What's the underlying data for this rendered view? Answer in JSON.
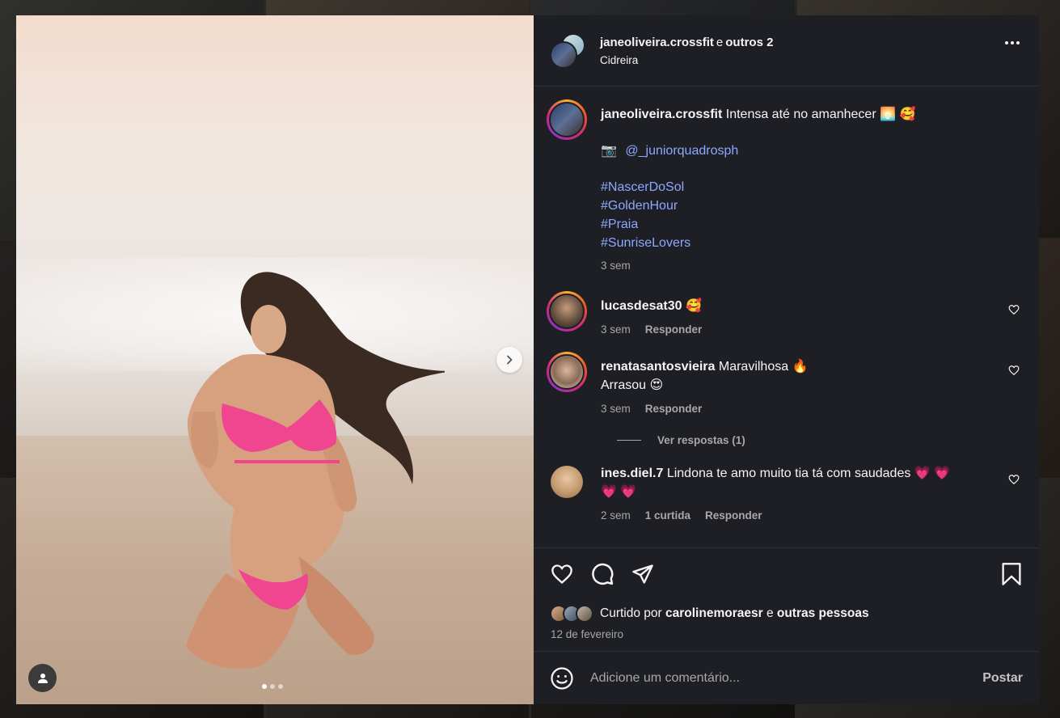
{
  "header": {
    "username": "janeoliveira.crossfit",
    "connector": "e",
    "others": "outros 2",
    "location": "Cidreira"
  },
  "caption": {
    "username": "janeoliveira.crossfit",
    "text": "Intensa até no amanhecer",
    "emoji": "🌅 🥰",
    "camera_emoji": "📷",
    "mention": "@_juniorquadrosph",
    "hashtags": [
      "#NascerDoSol",
      "#GoldenHour",
      "#Praia",
      "#SunriseLovers"
    ],
    "time": "3 sem"
  },
  "comments": [
    {
      "username": "lucasdesat30",
      "text": "",
      "emoji": "🥰",
      "time": "3 sem",
      "reply": "Responder"
    },
    {
      "username": "renatasantosvieira",
      "text": "Maravilhosa",
      "emoji": "🔥",
      "line2": "Arrasou",
      "line2_emoji": "😍",
      "time": "3 sem",
      "reply": "Responder",
      "view_replies": "Ver respostas (1)"
    },
    {
      "username": "ines.diel.7",
      "text": "Lindona te amo muito tia tá com saudades",
      "emoji": "💗 💗",
      "line2_emoji": "💗 💗",
      "time": "2 sem",
      "likes": "1 curtida",
      "reply": "Responder"
    }
  ],
  "likes": {
    "prefix": "Curtido por",
    "user": "carolinemoraesr",
    "connector": "e",
    "others": "outras pessoas"
  },
  "date": "12 de fevereiro",
  "add_comment": {
    "placeholder": "Adicione um comentário...",
    "post_label": "Postar"
  },
  "carousel": {
    "slides": 3,
    "active": 1
  },
  "icons": {
    "more": "more-horizontal-icon",
    "next": "chevron-right-icon",
    "tag": "user-tag-icon",
    "like": "heart-icon",
    "comment": "comment-icon",
    "share": "send-icon",
    "save": "bookmark-icon",
    "emoji": "smiley-icon"
  },
  "colors": {
    "background": "#1e1f24",
    "link": "#8da8ff",
    "muted": "#a8a8a8"
  }
}
